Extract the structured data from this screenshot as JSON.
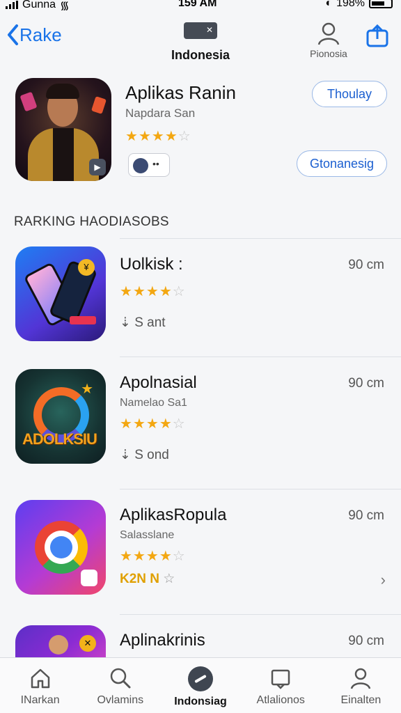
{
  "status": {
    "carrier": "Gunna",
    "time": "159 AM",
    "battery": "198%"
  },
  "nav": {
    "back_label": "Rake",
    "center_label": "Indonesia",
    "profile_label": "Pionosia"
  },
  "hero": {
    "title": "Aplikas Ranin",
    "subtitle": "Napdara San",
    "rating_stars": 3.5,
    "primary_button": "Thoulay",
    "secondary_button": "Gtonanesig"
  },
  "section_title": "RARKING HAODIASOBS",
  "apps": [
    {
      "title": "Uolkisk :",
      "subtitle": "",
      "size": "90 cm",
      "rating_stars": 3.5,
      "meta": "S ant"
    },
    {
      "title": "Apolnasial",
      "subtitle": "Namelao Sa1",
      "size": "90 cm",
      "rating_stars": 3.5,
      "meta": "S ond",
      "icon_text": "ADOLKSIU"
    },
    {
      "title": "AplikasRopula",
      "subtitle": "Salasslane",
      "size": "90 cm",
      "rating_stars": 3.5,
      "meta": "K2N N"
    },
    {
      "title": "Aplinakrinis",
      "subtitle": "",
      "size": "90 cm"
    }
  ],
  "tabs": [
    {
      "label": "INarkan",
      "icon": "home-icon"
    },
    {
      "label": "Ovlamins",
      "icon": "search-icon"
    },
    {
      "label": "Indonsiag",
      "icon": "compass-icon"
    },
    {
      "label": "Atlalionos",
      "icon": "apps-icon"
    },
    {
      "label": "Einalten",
      "icon": "person-icon"
    }
  ]
}
